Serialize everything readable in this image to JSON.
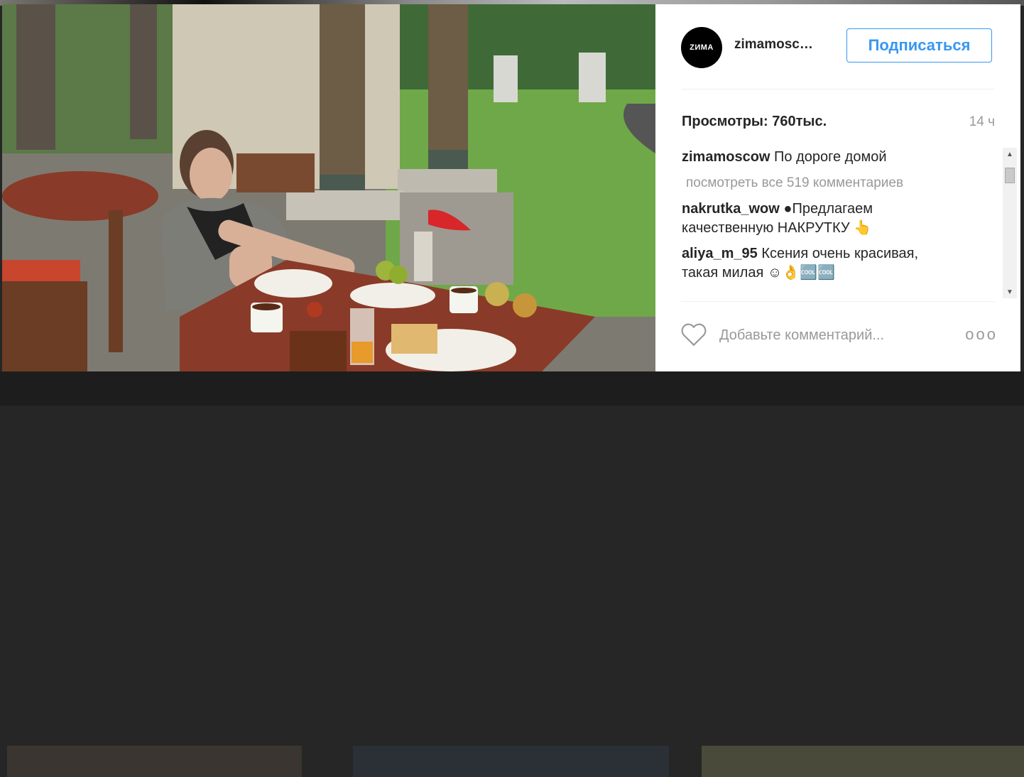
{
  "post": {
    "avatar_text": "ZИМА",
    "username": "zimamosc…",
    "follow_label": "Подписаться",
    "views": "Просмотры: 760тыс.",
    "time_ago": "14 ч"
  },
  "comments": {
    "caption": {
      "user": "zimamoscow",
      "text": "По дороге домой"
    },
    "view_all": "посмотреть все 519 комментариев",
    "items": [
      {
        "user": "nakrutka_wow",
        "text": "●Предлагаем",
        "text2": "качественную НАКРУТКУ 👆"
      },
      {
        "user": "aliya_m_95",
        "text": "Ксения очень красивая,",
        "text2": "такая милая ☺👌🆒🆒"
      }
    ]
  },
  "footer": {
    "add_comment_placeholder": "Добавьте комментарий...",
    "more_label": "ooo"
  },
  "icons": {
    "like": "heart-icon",
    "more": "more-options-icon",
    "scroll_up": "scroll-up-arrow-icon",
    "scroll_down": "scroll-down-arrow-icon"
  },
  "colors": {
    "accent": "#3897f0",
    "text": "#262626",
    "muted": "#999999",
    "avatar_bg": "#000000"
  }
}
